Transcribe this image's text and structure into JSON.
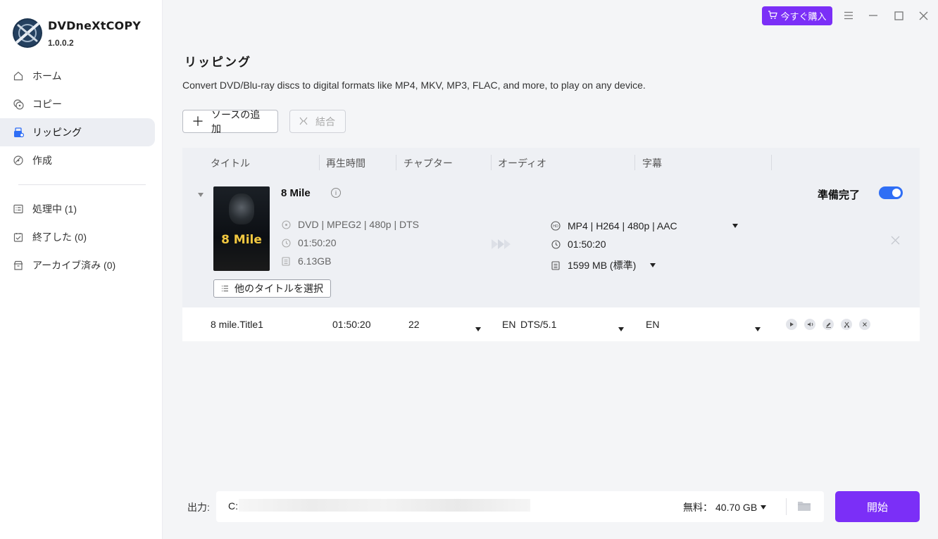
{
  "app": {
    "name": "DVDneXtCOPY",
    "version": "1.0.0.2"
  },
  "nav": {
    "items": [
      {
        "label": "ホーム",
        "icon": "home-icon"
      },
      {
        "label": "コピー",
        "icon": "copy-disc-icon"
      },
      {
        "label": "リッピング",
        "icon": "rip-icon",
        "active": true
      },
      {
        "label": "作成",
        "icon": "create-disc-icon"
      }
    ],
    "tasks": [
      {
        "label": "処理中 (1)",
        "icon": "processing-icon"
      },
      {
        "label": "終了した (0)",
        "icon": "finished-icon"
      },
      {
        "label": "アーカイブ済み (0)",
        "icon": "archive-icon"
      }
    ]
  },
  "titlebar": {
    "buy_label": "今すぐ購入"
  },
  "page": {
    "title": "リッピング",
    "description": "Convert DVD/Blu-ray discs to digital formats like MP4, MKV, MP3, FLAC, and more, to play on any device."
  },
  "toolbar": {
    "add_source": "ソースの追加",
    "merge": "結合"
  },
  "table": {
    "columns": [
      "タイトル",
      "再生時間",
      "チャプター",
      "オーディオ",
      "字幕"
    ]
  },
  "source": {
    "title": "8 Mile",
    "poster_text": "8 Mile",
    "format": "DVD | MPEG2 | 480p | DTS",
    "duration": "01:50:20",
    "size": "6.13GB",
    "select_titles": "他のタイトルを選択",
    "ready_label": "準備完了",
    "ready": true,
    "output_format": "MP4 | H264 | 480p | AAC",
    "output_duration": "01:50:20",
    "output_size": "1599 MB (標準)"
  },
  "title_row": {
    "name": "8 mile.Title1",
    "duration": "01:50:20",
    "chapters": "22",
    "audio_lang": "EN",
    "audio_codec": "DTS/5.1",
    "subtitle": "EN"
  },
  "footer": {
    "output_label": "出力:",
    "output_path_prefix": "C:",
    "free_label": "無料：",
    "free_value": "40.70 GB",
    "start_label": "開始"
  },
  "colors": {
    "accent": "#7b2ff7",
    "toggle": "#2f6ef5"
  }
}
